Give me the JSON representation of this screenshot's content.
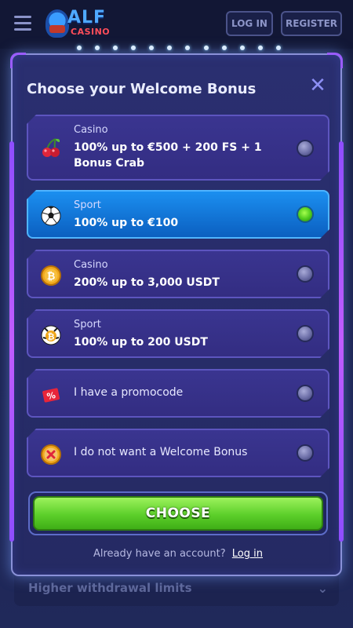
{
  "header": {
    "logo_top": "ALF",
    "logo_bottom": "CASINO",
    "login_label": "LOG IN",
    "register_label": "REGISTER"
  },
  "background": {
    "row_label": "Higher withdrawal limits"
  },
  "modal": {
    "title": "Choose your Welcome Bonus",
    "options": [
      {
        "category": "Casino",
        "title": "100% up to €500 + 200 FS + 1 Bonus Crab",
        "icon": "cherry-icon",
        "selected": false
      },
      {
        "category": "Sport",
        "title": "100% up to €100",
        "icon": "soccer-ball-icon",
        "selected": true
      },
      {
        "category": "Casino",
        "title": "200% up to 3,000 USDT",
        "icon": "bitcoin-coin-icon",
        "selected": false
      },
      {
        "category": "Sport",
        "title": "100% up to 200 USDT",
        "icon": "crypto-ball-icon",
        "selected": false
      },
      {
        "text": "I have a promocode",
        "icon": "percent-ticket-icon",
        "selected": false
      },
      {
        "text": "I do not want a Welcome Bonus",
        "icon": "no-bonus-icon",
        "selected": false
      }
    ],
    "choose_label": "CHOOSE",
    "account_prompt": "Already have an account?",
    "login_link": "Log in"
  },
  "colors": {
    "selected_option": "#1b8ff0",
    "choose_button": "#5ccf2a",
    "modal_bg": "#2a2f70"
  }
}
